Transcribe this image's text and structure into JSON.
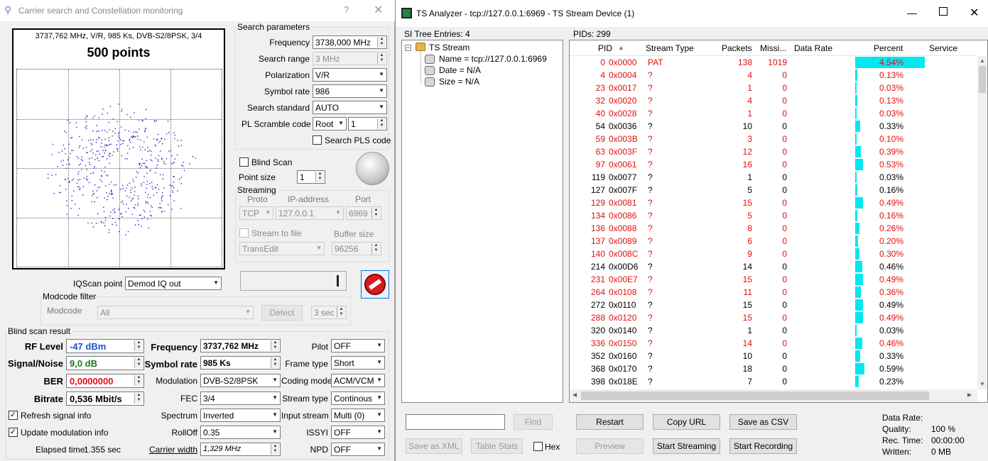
{
  "left": {
    "title": "Carrier search and Constellation monitoring",
    "help": "?",
    "close": "✕",
    "const_info": "3737,762 MHz, V/R, 985 Ks, DVB-S2/8PSK, 3/4",
    "const_points": "500 points",
    "search_params": {
      "legend": "Search parameters",
      "frequency_label": "Frequency",
      "frequency": "3738,000 MHz",
      "range_label": "Search range",
      "range": "3 MHz",
      "pol_label": "Polarization",
      "pol": "V/R",
      "sr_label": "Symbol rate",
      "sr": "986",
      "std_label": "Search standard",
      "std": "AUTO",
      "pls_label": "PL Scramble code",
      "pls_mode": "Root",
      "pls_val": "1",
      "search_pls": "Search PLS code"
    },
    "blind_scan": "Blind Scan",
    "point_size_label": "Point size",
    "point_size": "1",
    "streaming": {
      "legend": "Streaming",
      "proto_label": "Proto",
      "ip_label": "IP-address",
      "port_label": "Port",
      "proto": "TCP",
      "ip": "127.0.0.1",
      "port": "6969",
      "stream_to_file": "Stream to file",
      "buffer_label": "Buffer size",
      "app": "TransEdit",
      "buffer": "96256"
    },
    "iqscan_label": "IQScan point",
    "iqscan": "Demod IQ out",
    "modcode": {
      "legend": "Modcode filter",
      "label": "Modcode",
      "value": "All",
      "detect": "Detect",
      "time": "3 sec"
    },
    "result": {
      "legend": "Blind scan result",
      "rf_label": "RF Level",
      "rf": "-47 dBm",
      "sn_label": "Signal/Noise",
      "sn": "9,0 dB",
      "ber_label": "BER",
      "ber": "0,0000000",
      "bitrate_label": "Bitrate",
      "bitrate": "0,536 Mbit/s",
      "freq_label": "Frequency",
      "freq": "3737,762 MHz",
      "sr_label": "Symbol rate",
      "sr": "985 Ks",
      "mod_label": "Modulation",
      "mod": "DVB-S2/8PSK",
      "fec_label": "FEC",
      "fec": "3/4",
      "spec_label": "Spectrum",
      "spec": "Inverted",
      "roll_label": "RollOff",
      "roll": "0.35",
      "cw_label": "Carrier width",
      "cw": "1,329 MHz",
      "pilot_label": "Pilot",
      "pilot": "OFF",
      "frame_label": "Frame type",
      "frame": "Short",
      "coding_label": "Coding mode",
      "coding": "ACM/VCM",
      "stype_label": "Stream type",
      "stype": "Continous",
      "istream_label": "Input stream",
      "istream": "Multi (0)",
      "issyi_label": "ISSYI",
      "issyi": "OFF",
      "npd_label": "NPD",
      "npd": "OFF",
      "refresh": "Refresh signal info",
      "update": "Update modulation info",
      "elapsed_label": "Elapsed time:",
      "elapsed": "1.355 sec"
    }
  },
  "right": {
    "title": "TS Analyzer - tcp://127.0.0.1:6969 - TS Stream Device (1)",
    "si_label": "SI Tree Entries: 4",
    "pids_label": "PIDs: 299",
    "tree": {
      "root": "TS Stream",
      "items": [
        "Name = tcp://127.0.0.1:6969",
        "Date = N/A",
        "Size = N/A"
      ]
    },
    "cols": [
      "PID",
      "Stream Type",
      "Packets",
      "Missi...",
      "Data Rate",
      "Percent",
      "Service"
    ],
    "rows": [
      {
        "pid": "0",
        "hex": "0x0000",
        "type": "PAT",
        "pk": "138",
        "miss": "1019",
        "pct": "4.54%",
        "red": true
      },
      {
        "pid": "4",
        "hex": "0x0004",
        "type": "?",
        "pk": "4",
        "miss": "0",
        "pct": "0.13%",
        "red": true
      },
      {
        "pid": "23",
        "hex": "0x0017",
        "type": "?",
        "pk": "1",
        "miss": "0",
        "pct": "0.03%",
        "red": true
      },
      {
        "pid": "32",
        "hex": "0x0020",
        "type": "?",
        "pk": "4",
        "miss": "0",
        "pct": "0.13%",
        "red": true
      },
      {
        "pid": "40",
        "hex": "0x0028",
        "type": "?",
        "pk": "1",
        "miss": "0",
        "pct": "0.03%",
        "red": true
      },
      {
        "pid": "54",
        "hex": "0x0036",
        "type": "?",
        "pk": "10",
        "miss": "0",
        "pct": "0.33%",
        "red": false
      },
      {
        "pid": "59",
        "hex": "0x003B",
        "type": "?",
        "pk": "3",
        "miss": "0",
        "pct": "0.10%",
        "red": true
      },
      {
        "pid": "63",
        "hex": "0x003F",
        "type": "?",
        "pk": "12",
        "miss": "0",
        "pct": "0.39%",
        "red": true
      },
      {
        "pid": "97",
        "hex": "0x0061",
        "type": "?",
        "pk": "16",
        "miss": "0",
        "pct": "0.53%",
        "red": true
      },
      {
        "pid": "119",
        "hex": "0x0077",
        "type": "?",
        "pk": "1",
        "miss": "0",
        "pct": "0.03%",
        "red": false
      },
      {
        "pid": "127",
        "hex": "0x007F",
        "type": "?",
        "pk": "5",
        "miss": "0",
        "pct": "0.16%",
        "red": false
      },
      {
        "pid": "129",
        "hex": "0x0081",
        "type": "?",
        "pk": "15",
        "miss": "0",
        "pct": "0.49%",
        "red": true
      },
      {
        "pid": "134",
        "hex": "0x0086",
        "type": "?",
        "pk": "5",
        "miss": "0",
        "pct": "0.16%",
        "red": true
      },
      {
        "pid": "136",
        "hex": "0x0088",
        "type": "?",
        "pk": "8",
        "miss": "0",
        "pct": "0.26%",
        "red": true
      },
      {
        "pid": "137",
        "hex": "0x0089",
        "type": "?",
        "pk": "6",
        "miss": "0",
        "pct": "0.20%",
        "red": true
      },
      {
        "pid": "140",
        "hex": "0x008C",
        "type": "?",
        "pk": "9",
        "miss": "0",
        "pct": "0.30%",
        "red": true
      },
      {
        "pid": "214",
        "hex": "0x00D6",
        "type": "?",
        "pk": "14",
        "miss": "0",
        "pct": "0.46%",
        "red": false
      },
      {
        "pid": "231",
        "hex": "0x00E7",
        "type": "?",
        "pk": "15",
        "miss": "0",
        "pct": "0.49%",
        "red": true
      },
      {
        "pid": "264",
        "hex": "0x0108",
        "type": "?",
        "pk": "11",
        "miss": "0",
        "pct": "0.36%",
        "red": true
      },
      {
        "pid": "272",
        "hex": "0x0110",
        "type": "?",
        "pk": "15",
        "miss": "0",
        "pct": "0.49%",
        "red": false
      },
      {
        "pid": "288",
        "hex": "0x0120",
        "type": "?",
        "pk": "15",
        "miss": "0",
        "pct": "0.49%",
        "red": true
      },
      {
        "pid": "320",
        "hex": "0x0140",
        "type": "?",
        "pk": "1",
        "miss": "0",
        "pct": "0.03%",
        "red": false
      },
      {
        "pid": "336",
        "hex": "0x0150",
        "type": "?",
        "pk": "14",
        "miss": "0",
        "pct": "0.46%",
        "red": true
      },
      {
        "pid": "352",
        "hex": "0x0160",
        "type": "?",
        "pk": "10",
        "miss": "0",
        "pct": "0.33%",
        "red": false
      },
      {
        "pid": "368",
        "hex": "0x0170",
        "type": "?",
        "pk": "18",
        "miss": "0",
        "pct": "0.59%",
        "red": false
      },
      {
        "pid": "398",
        "hex": "0x018E",
        "type": "?",
        "pk": "7",
        "miss": "0",
        "pct": "0.23%",
        "red": false
      }
    ],
    "find": "Find",
    "save_xml": "Save as XML",
    "table_stats": "Table Stats",
    "hex": "Hex",
    "restart": "Restart",
    "copy_url": "Copy URL",
    "save_csv": "Save as CSV",
    "preview": "Preview",
    "start_streaming": "Start Streaming",
    "start_recording": "Start Recording",
    "stats": {
      "dr_label": "Data Rate:",
      "q_label": "Quality:",
      "q": "100 %",
      "rt_label": "Rec. Time:",
      "rt": "00:00:00",
      "w_label": "Written:",
      "w": "0 MB"
    }
  },
  "colors": {
    "red": "#e01010",
    "bar": "#00e8f0",
    "rf": "#1a4fd6",
    "sn": "#1a7a1a",
    "ber": "#e01010"
  }
}
